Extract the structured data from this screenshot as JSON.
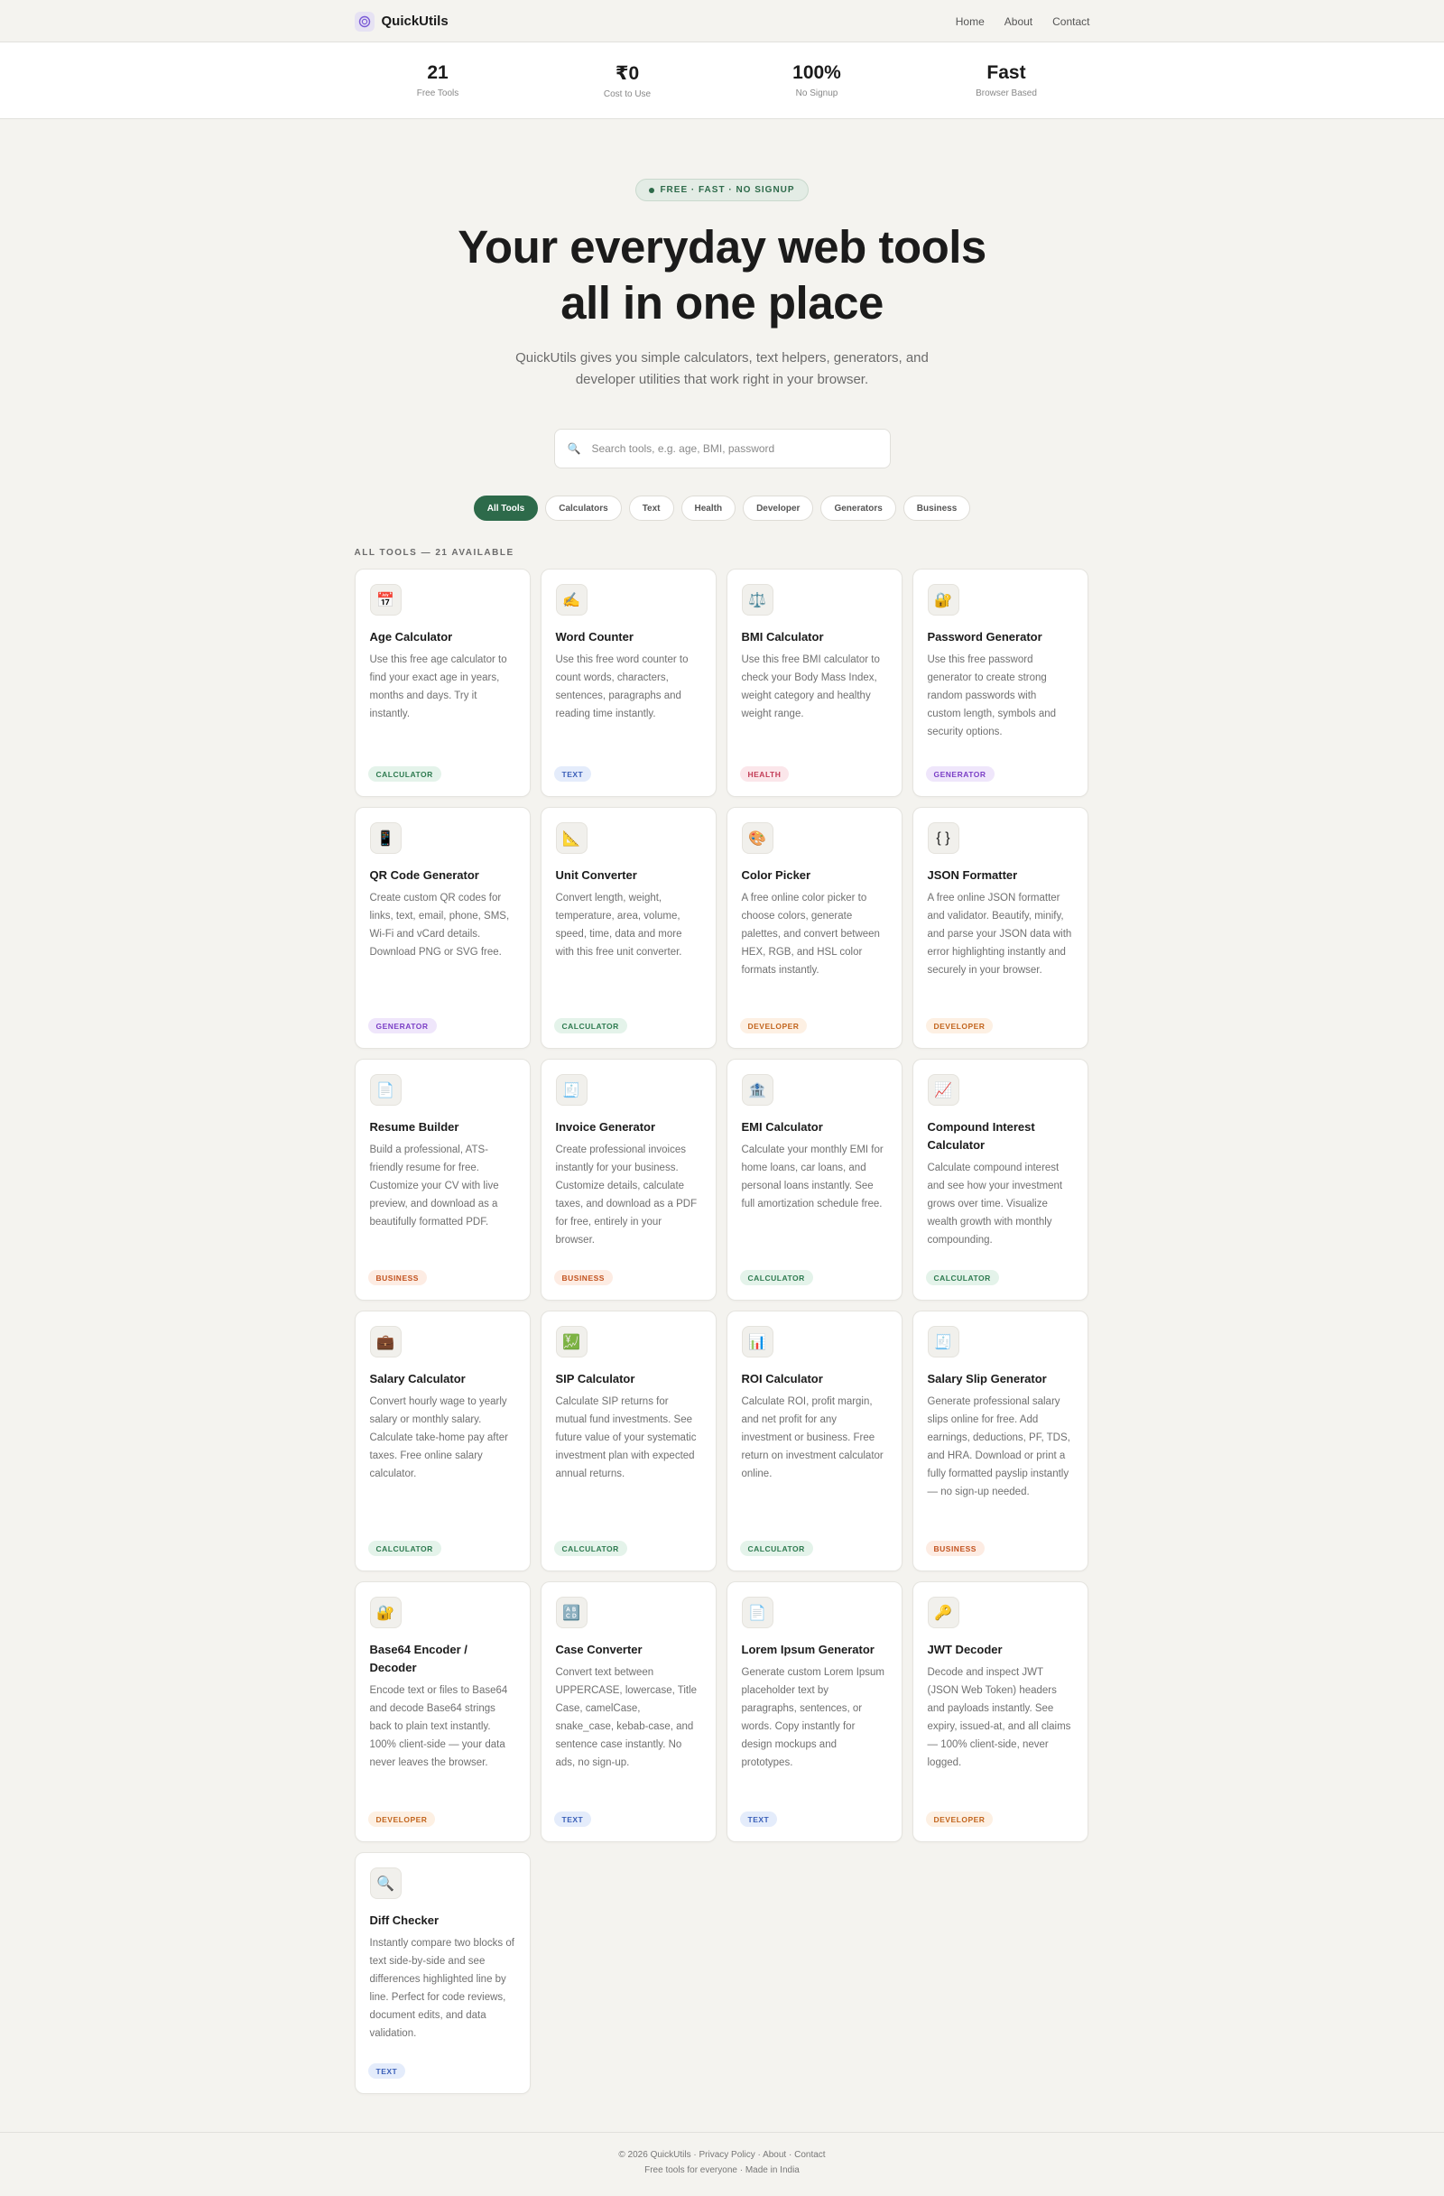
{
  "nav": {
    "logo_icon": "spiral-logo",
    "brand": "QuickUtils",
    "links": [
      "Home",
      "About",
      "Contact"
    ]
  },
  "stats": [
    {
      "value": "21",
      "label": "Free Tools"
    },
    {
      "value": "₹0",
      "label": "Cost to Use"
    },
    {
      "value": "100%",
      "label": "No Signup"
    },
    {
      "value": "Fast",
      "label": "Browser Based"
    }
  ],
  "hero": {
    "pill": "FREE · FAST · NO SIGNUP",
    "title_line1": "Your everyday web tools",
    "title_line2": "all in one place",
    "subtitle": "QuickUtils gives you simple calculators, text helpers, generators, and developer utilities that work right in your browser."
  },
  "search": {
    "icon": "🔍",
    "placeholder": "Search tools, e.g. age, BMI, password"
  },
  "filters": [
    "All Tools",
    "Calculators",
    "Text",
    "Health",
    "Developer",
    "Generators",
    "Business"
  ],
  "tools_section": {
    "label": "ALL TOOLS — 21 AVAILABLE"
  },
  "badge_colors": {
    "CALCULATOR": {
      "bg": "#e4f3ea",
      "fg": "#2d7a4f"
    },
    "TEXT": {
      "bg": "#e4ecfb",
      "fg": "#3a5fb8"
    },
    "HEALTH": {
      "bg": "#fbe6ea",
      "fg": "#c23a55"
    },
    "GENERATOR": {
      "bg": "#efe6fb",
      "fg": "#7b3fc6"
    },
    "DEVELOPER": {
      "bg": "#fdf0e3",
      "fg": "#c2651e"
    },
    "BUSINESS": {
      "bg": "#fdece3",
      "fg": "#c2521e"
    }
  },
  "tools": [
    {
      "icon": "📅",
      "title": "Age Calculator",
      "desc": "Use this free age calculator to find your exact age in years, months and days. Try it instantly.",
      "badge": "CALCULATOR"
    },
    {
      "icon": "✍️",
      "title": "Word Counter",
      "desc": "Use this free word counter to count words, characters, sentences, paragraphs and reading time instantly.",
      "badge": "TEXT"
    },
    {
      "icon": "⚖️",
      "title": "BMI Calculator",
      "desc": "Use this free BMI calculator to check your Body Mass Index, weight category and healthy weight range.",
      "badge": "HEALTH"
    },
    {
      "icon": "🔐",
      "title": "Password Generator",
      "desc": "Use this free password generator to create strong random passwords with custom length, symbols and security options.",
      "badge": "GENERATOR"
    },
    {
      "icon": "📱",
      "title": "QR Code Generator",
      "desc": "Create custom QR codes for links, text, email, phone, SMS, Wi-Fi and vCard details. Download PNG or SVG free.",
      "badge": "GENERATOR"
    },
    {
      "icon": "📐",
      "title": "Unit Converter",
      "desc": "Convert length, weight, temperature, area, volume, speed, time, data and more with this free unit converter.",
      "badge": "CALCULATOR"
    },
    {
      "icon": "🎨",
      "title": "Color Picker",
      "desc": "A free online color picker to choose colors, generate palettes, and convert between HEX, RGB, and HSL color formats instantly.",
      "badge": "DEVELOPER"
    },
    {
      "icon": "{ }",
      "title": "JSON Formatter",
      "desc": "A free online JSON formatter and validator. Beautify, minify, and parse your JSON data with error highlighting instantly and securely in your browser.",
      "badge": "DEVELOPER"
    },
    {
      "icon": "📄",
      "title": "Resume Builder",
      "desc": "Build a professional, ATS-friendly resume for free. Customize your CV with live preview, and download as a beautifully formatted PDF.",
      "badge": "BUSINESS"
    },
    {
      "icon": "🧾",
      "title": "Invoice Generator",
      "desc": "Create professional invoices instantly for your business. Customize details, calculate taxes, and download as a PDF for free, entirely in your browser.",
      "badge": "BUSINESS"
    },
    {
      "icon": "🏦",
      "title": "EMI Calculator",
      "desc": "Calculate your monthly EMI for home loans, car loans, and personal loans instantly. See full amortization schedule free.",
      "badge": "CALCULATOR"
    },
    {
      "icon": "📈",
      "title": "Compound Interest Calculator",
      "desc": "Calculate compound interest and see how your investment grows over time. Visualize wealth growth with monthly compounding.",
      "badge": "CALCULATOR"
    },
    {
      "icon": "💼",
      "title": "Salary Calculator",
      "desc": "Convert hourly wage to yearly salary or monthly salary. Calculate take-home pay after taxes. Free online salary calculator.",
      "badge": "CALCULATOR"
    },
    {
      "icon": "💹",
      "title": "SIP Calculator",
      "desc": "Calculate SIP returns for mutual fund investments. See future value of your systematic investment plan with expected annual returns.",
      "badge": "CALCULATOR"
    },
    {
      "icon": "📊",
      "title": "ROI Calculator",
      "desc": "Calculate ROI, profit margin, and net profit for any investment or business. Free return on investment calculator online.",
      "badge": "CALCULATOR"
    },
    {
      "icon": "🧾",
      "title": "Salary Slip Generator",
      "desc": "Generate professional salary slips online for free. Add earnings, deductions, PF, TDS, and HRA. Download or print a fully formatted payslip instantly — no sign-up needed.",
      "badge": "BUSINESS"
    },
    {
      "icon": "🔐",
      "title": "Base64 Encoder / Decoder",
      "desc": "Encode text or files to Base64 and decode Base64 strings back to plain text instantly. 100% client-side — your data never leaves the browser.",
      "badge": "DEVELOPER"
    },
    {
      "icon": "🔠",
      "title": "Case Converter",
      "desc": "Convert text between UPPERCASE, lowercase, Title Case, camelCase, snake_case, kebab-case, and sentence case instantly. No ads, no sign-up.",
      "badge": "TEXT"
    },
    {
      "icon": "📄",
      "title": "Lorem Ipsum Generator",
      "desc": "Generate custom Lorem Ipsum placeholder text by paragraphs, sentences, or words. Copy instantly for design mockups and prototypes.",
      "badge": "TEXT"
    },
    {
      "icon": "🔑",
      "title": "JWT Decoder",
      "desc": "Decode and inspect JWT (JSON Web Token) headers and payloads instantly. See expiry, issued-at, and all claims — 100% client-side, never logged.",
      "badge": "DEVELOPER"
    },
    {
      "icon": "🔍",
      "title": "Diff Checker",
      "desc": "Instantly compare two blocks of text side-by-side and see differences highlighted line by line. Perfect for code reviews, document edits, and data validation.",
      "badge": "TEXT"
    }
  ],
  "footer": {
    "copyright": "© 2026 QuickUtils",
    "links": [
      "Privacy Policy",
      "About",
      "Contact"
    ],
    "tagline": "Free tools for everyone · Made in India"
  }
}
